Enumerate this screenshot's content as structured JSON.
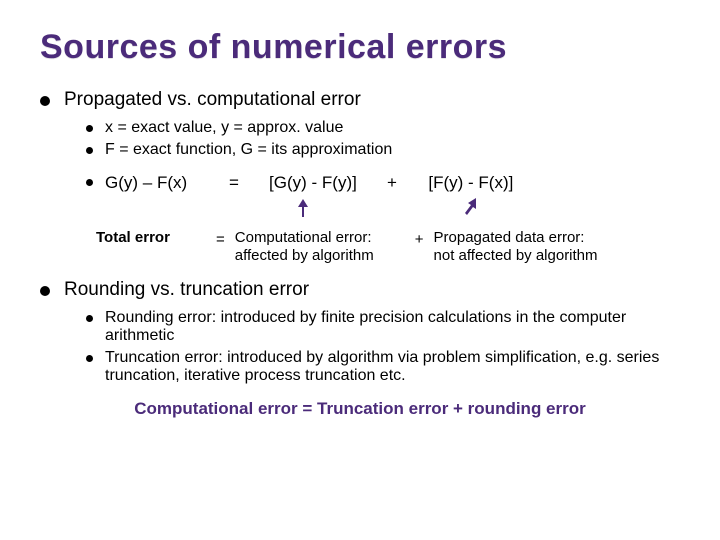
{
  "title": "Sources of numerical errors",
  "section1": {
    "heading": "Propagated vs. computational error",
    "def_xy": "x = exact value, y = approx. value",
    "def_FG": "F = exact function, G = its approximation",
    "eq": {
      "lhs": "G(y) – F(x)",
      "eq_sign": "=",
      "mid": "[G(y) - F(y)]",
      "plus": "+",
      "rhs": "[F(y) - F(x)]"
    },
    "labels": {
      "total": "Total error",
      "eq_sign": "=",
      "comp_l1": "Computational error:",
      "comp_l2": "affected by algorithm",
      "plus": "+",
      "prop_l1": "Propagated data error:",
      "prop_l2": "not affected by algorithm"
    }
  },
  "section2": {
    "heading": "Rounding vs. truncation error",
    "round": "Rounding error: introduced by finite precision calculations in the computer arithmetic",
    "trunc": "Truncation error: introduced by algorithm via problem simplification, e.g. series truncation, iterative process truncation etc."
  },
  "footer": "Computational error = Truncation error + rounding error"
}
